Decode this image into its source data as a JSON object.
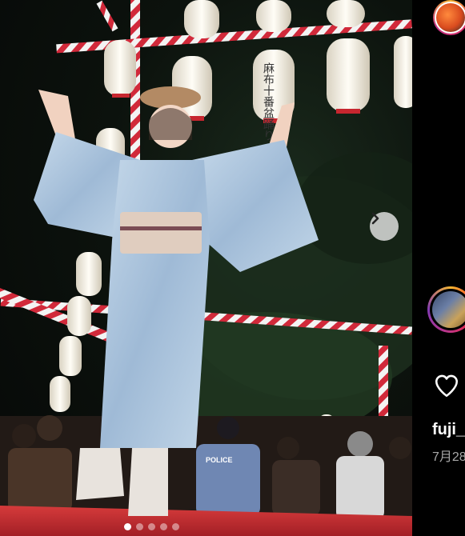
{
  "post": {
    "username": "fuji_",
    "date": "7月28",
    "carousel": {
      "total_slides": 5,
      "active_index": 0
    }
  },
  "photo": {
    "lantern_text": "麻布十番盆踊り",
    "police_vest_text": "POLICE"
  },
  "icons": {
    "next": "chevron-right-icon",
    "like": "heart-icon"
  },
  "colors": {
    "accent_story_ring": "#e1306c",
    "secondary_text": "#a8a8a8"
  }
}
